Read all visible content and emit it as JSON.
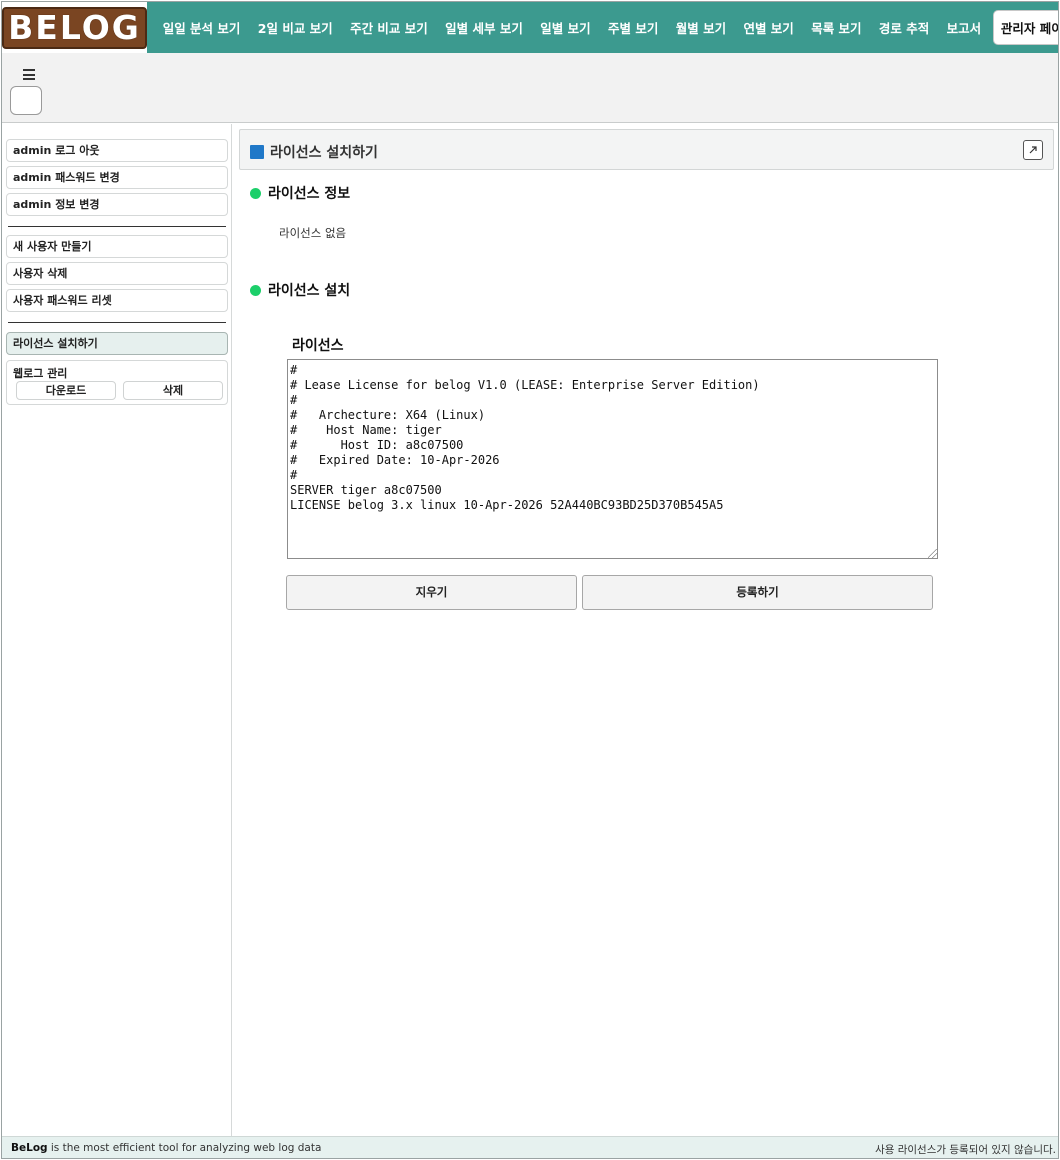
{
  "app": {
    "logo_text": "BELOG"
  },
  "nav": {
    "items": [
      "일일 분석 보기",
      "2일 비교 보기",
      "주간 비교 보기",
      "일별 세부 보기",
      "일별 보기",
      "주별 보기",
      "월별 보기",
      "연별 보기",
      "목록 보기",
      "경로 추적",
      "보고서"
    ],
    "active": "관리자 페이지"
  },
  "sidebar": {
    "admin": [
      "admin 로그 아웃",
      "admin 패스워드 변경",
      "admin 정보 변경"
    ],
    "users": [
      "새 사용자 만들기",
      "사용자 삭제",
      "사용자 패스워드 리셋"
    ],
    "license": "라이선스 설치하기",
    "weblog": {
      "title": "웹로그 관리",
      "download": "다운로드",
      "delete": "삭제"
    }
  },
  "main": {
    "panel_title": "라이선스 설치하기",
    "info_title": "라이선스 정보",
    "info_value": "라이선스 없음",
    "install_title": "라이선스 설치",
    "license_label": "라이선스",
    "license_text": "#\n# Lease License for belog V1.0 (LEASE: Enterprise Server Edition)\n#\n#   Archecture: X64 (Linux)\n#    Host Name: tiger\n#      Host ID: a8c07500\n#   Expired Date: 10-Apr-2026\n#\nSERVER tiger a8c07500\nLICENSE belog 3.x linux 10-Apr-2026 52A440BC93BD25D370B545A5",
    "clear_button": "지우기",
    "register_button": "등록하기"
  },
  "footer": {
    "brand": "BeLog",
    "tagline": " is the most efficient tool for analyzing web log data",
    "status": "사용 라이선스가 등록되어 있지 않습니다."
  },
  "colors": {
    "nav_bg": "#3c9a8f",
    "logo_bg": "#7a4522",
    "accent_blue": "#1f78c8",
    "status_green": "#1ccf6a",
    "footer_bg": "#e6f1ef"
  },
  "icons": {
    "menu": "hamburger-icon",
    "popout": "external-link-icon",
    "panel": "square-icon",
    "bullet": "green-dot-icon"
  }
}
